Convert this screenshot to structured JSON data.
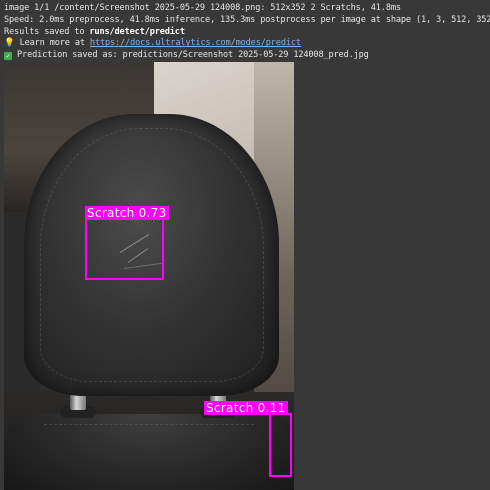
{
  "log": {
    "line1": "image 1/1 /content/Screenshot 2025-05-29 124008.png: 512x352 2 Scratchs, 41.8ms",
    "line2": "Speed: 2.0ms preprocess, 41.8ms inference, 135.3ms postprocess per image at shape (1, 3, 512, 352)",
    "line3_prefix": "Results saved to ",
    "line3_path": "runs/detect/predict",
    "line4_icon": "💡",
    "line4_prefix": " Learn more at ",
    "line4_link": "https://docs.ultralytics.com/modes/predict",
    "line5_icon": "✓",
    "line5_text": " Prediction saved as: predictions/Screenshot 2025-05-29 124008_pred.jpg"
  },
  "detections": [
    {
      "label": "Scratch 0.73",
      "class": "Scratch",
      "confidence": 0.73
    },
    {
      "label": "Scratch 0.11",
      "class": "Scratch",
      "confidence": 0.11
    }
  ],
  "colors": {
    "background": "#383838",
    "text": "#e6e6e6",
    "link": "#7fb3e6",
    "detection_box": "#ff00ff"
  },
  "icons": [
    "light-bulb-icon",
    "check-mark-icon"
  ]
}
